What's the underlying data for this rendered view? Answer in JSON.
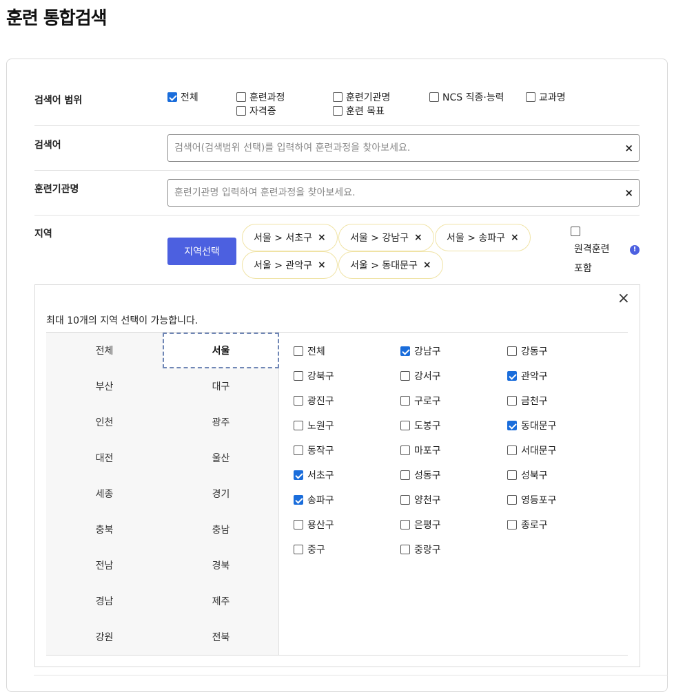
{
  "page_title": "훈련 통합검색",
  "scope": {
    "label": "검색어 범위",
    "options": [
      {
        "label": "전체",
        "checked": true
      },
      {
        "label": "훈련과정",
        "checked": false
      },
      {
        "label": "훈련기관명",
        "checked": false
      },
      {
        "label": "NCS 직종·능력",
        "checked": false
      },
      {
        "label": "교과명",
        "checked": false
      },
      {
        "label": "자격증",
        "checked": false
      },
      {
        "label": "훈련 목표",
        "checked": false
      }
    ]
  },
  "keyword": {
    "label": "검색어",
    "placeholder": "검색어(검색범위 선택)를 입력하여 훈련과정을 찾아보세요.",
    "value": "",
    "clear": "×"
  },
  "institution": {
    "label": "훈련기관명",
    "placeholder": "훈련기관명 입력하여 훈련과정을 찾아보세요.",
    "value": "",
    "clear": "×"
  },
  "region": {
    "label": "지역",
    "button_label": "지역선택",
    "chips": [
      "서울 > 서초구",
      "서울 > 강남구",
      "서울 > 송파구",
      "서울 > 관악구",
      "서울 > 동대문구"
    ],
    "chip_close": "×",
    "remote_label": "원격훈련포함",
    "remote_checked": false,
    "info_icon": "info-icon",
    "info_glyph": "!"
  },
  "popup": {
    "close": "×",
    "notice": "최대 10개의 지역 선택이 가능합니다.",
    "provinces": [
      "전체",
      "서울",
      "부산",
      "대구",
      "인천",
      "광주",
      "대전",
      "울산",
      "세종",
      "경기",
      "충북",
      "충남",
      "전남",
      "경북",
      "경남",
      "제주",
      "강원",
      "전북"
    ],
    "active_province": "서울",
    "districts": [
      {
        "label": "전체",
        "checked": false
      },
      {
        "label": "강남구",
        "checked": true
      },
      {
        "label": "강동구",
        "checked": false
      },
      {
        "label": "강북구",
        "checked": false
      },
      {
        "label": "강서구",
        "checked": false
      },
      {
        "label": "관악구",
        "checked": true
      },
      {
        "label": "광진구",
        "checked": false
      },
      {
        "label": "구로구",
        "checked": false
      },
      {
        "label": "금천구",
        "checked": false
      },
      {
        "label": "노원구",
        "checked": false
      },
      {
        "label": "도봉구",
        "checked": false
      },
      {
        "label": "동대문구",
        "checked": true
      },
      {
        "label": "동작구",
        "checked": false
      },
      {
        "label": "마포구",
        "checked": false
      },
      {
        "label": "서대문구",
        "checked": false
      },
      {
        "label": "서초구",
        "checked": true
      },
      {
        "label": "성동구",
        "checked": false
      },
      {
        "label": "성북구",
        "checked": false
      },
      {
        "label": "송파구",
        "checked": true
      },
      {
        "label": "양천구",
        "checked": false
      },
      {
        "label": "영등포구",
        "checked": false
      },
      {
        "label": "용산구",
        "checked": false
      },
      {
        "label": "은평구",
        "checked": false
      },
      {
        "label": "종로구",
        "checked": false
      },
      {
        "label": "중구",
        "checked": false
      },
      {
        "label": "중랑구",
        "checked": false
      }
    ]
  }
}
